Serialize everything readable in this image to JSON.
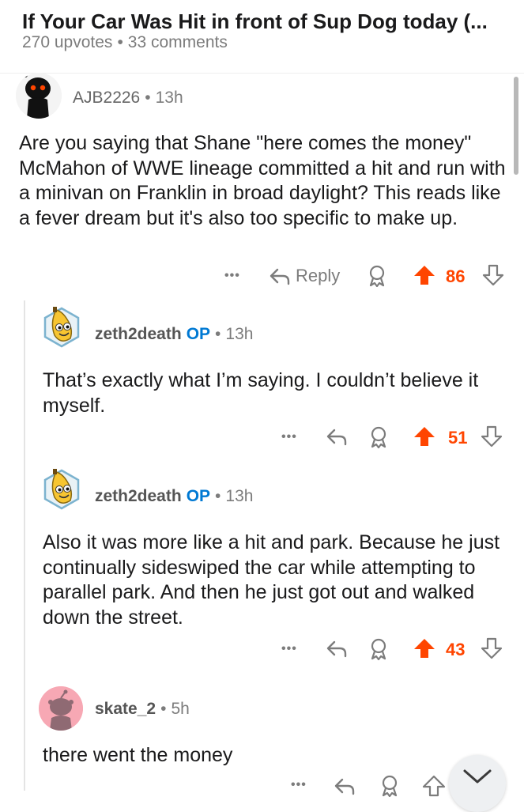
{
  "post": {
    "title": "If Your Car Was Hit in front of Sup Dog today (...",
    "upvotes": "270 upvotes",
    "comments": "33 comments"
  },
  "comments": [
    {
      "username": "AJB2226",
      "op_badge": "",
      "time": "13h",
      "body": "Are you saying that Shane \"here comes the money\" McMahon of WWE lineage committed a hit and run with a minivan on Franklin in broad daylight? This reads like a fever dream but it's also too specific to make up.",
      "reply_label": "Reply",
      "votes": "86",
      "upvoted": true
    },
    {
      "username": "zeth2death",
      "op_badge": "OP",
      "time": "13h",
      "body": "That’s exactly what I’m saying. I couldn’t believe it myself.",
      "votes": "51",
      "upvoted": true
    },
    {
      "username": "zeth2death",
      "op_badge": "OP",
      "time": "13h",
      "body": "Also it was more like a hit and park. Because he just continually sideswiped the car while attempting to parallel park. And then he just got out and walked down the street.",
      "votes": "43",
      "upvoted": true
    },
    {
      "username": "skate_2",
      "op_badge": "",
      "time": "5h",
      "body": "there went the money",
      "votes": "",
      "upvoted": false
    }
  ],
  "separator": "•",
  "more_label": "•••",
  "colors": {
    "upvote": "#ff4500",
    "op": "#0079d3",
    "meta": "#7c7c7c"
  },
  "icons": [
    "reply-arrow-icon",
    "award-icon",
    "upvote-arrow-icon",
    "downvote-arrow-icon",
    "chevron-down-icon",
    "snoo-avatar-icon",
    "banana-avatar-icon"
  ]
}
